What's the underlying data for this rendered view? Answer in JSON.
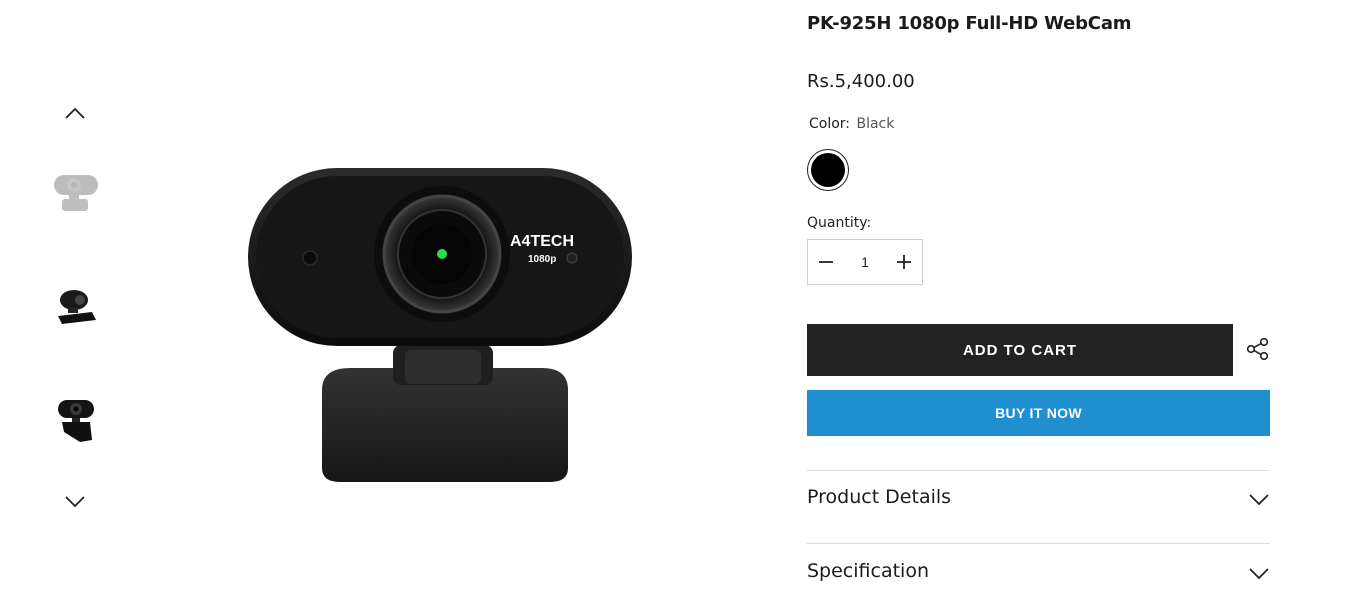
{
  "product": {
    "title": "PK-925H 1080p Full-HD WebCam",
    "price": "Rs.5,400.00",
    "brand_mark": "A4TECH",
    "resolution_mark": "1080p"
  },
  "color": {
    "label": "Color:",
    "value": "Black",
    "swatch_hex": "#000000"
  },
  "quantity": {
    "label": "Quantity:",
    "value": "1"
  },
  "actions": {
    "add_to_cart": "ADD TO CART",
    "buy_it_now": "BUY IT NOW"
  },
  "accordions": [
    {
      "label": "Product Details"
    },
    {
      "label": "Specification"
    }
  ],
  "gallery": {
    "thumbnails": [
      {
        "name": "webcam-front-view"
      },
      {
        "name": "webcam-side-view"
      },
      {
        "name": "webcam-angled-view"
      }
    ]
  },
  "theme": {
    "accent_blue": "#1f8fd0",
    "dark_button": "#232323"
  }
}
